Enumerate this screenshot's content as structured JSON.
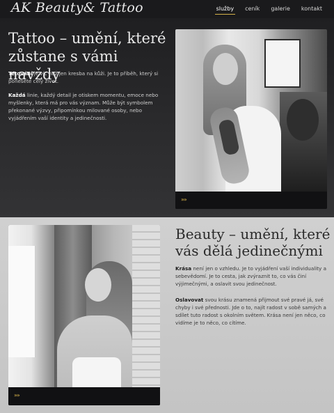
{
  "header": {
    "logo": "AK Beauty& Tattoo",
    "nav": [
      {
        "label": "služby",
        "active": true
      },
      {
        "label": "ceník",
        "active": false
      },
      {
        "label": "galerie",
        "active": false
      },
      {
        "label": "kontakt",
        "active": false
      }
    ]
  },
  "tattoo": {
    "title": "Tattoo – umění, které zůstane s vámi navždy",
    "p1_bold": "Tetování",
    "p1_rest": " je víc než jen kresba na kůži. Je to příběh, který si ponesete celý život.",
    "p2_bold": "Každá",
    "p2_rest": " linie, každý detail je otiskem momentu, emoce nebo myšlenky, která má pro vás význam. Může být symbolem překonané výzvy, připomínkou milované osoby, nebo vyjádřením vaší identity a jedinečnosti.",
    "more_icon": "triple-chevron-right-icon",
    "more_glyph": "»»"
  },
  "beauty": {
    "title": "Beauty – umění, které vás dělá jedinečnými",
    "p1_bold": "Krása",
    "p1_rest": " není jen o vzhledu. Je to vyjádření vaší individuality a sebevědomí. Je to cesta, jak zvýraznit to, co vás činí výjimečnými, a oslavit svou jedinečnost.",
    "p2_bold": "Oslavovat",
    "p2_rest": " svou krásu znamená přijmout své pravé já, své chyby i své přednosti. Jde o to, najít radost v sobě samých a sdílet tuto radost s okolním světem. Krása není jen něco, co vidíme je to něco, co cítíme.",
    "more_icon": "triple-chevron-right-icon",
    "more_glyph": "»»"
  },
  "colors": {
    "accent": "#d4b04a",
    "dark_bg": "#1f1f21",
    "light_bg": "#d0d0d0"
  }
}
